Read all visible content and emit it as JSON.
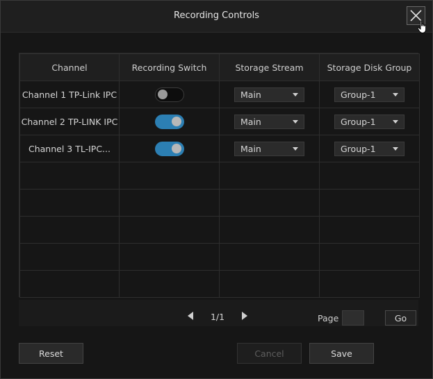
{
  "dialog": {
    "title": "Recording Controls",
    "close_icon": "close-icon"
  },
  "table": {
    "headers": [
      "Channel",
      "Recording Switch",
      "Storage Stream",
      "Storage Disk Group"
    ],
    "rows": [
      {
        "channel": "Channel 1 TP-Link IPC",
        "recording": false,
        "stream": "Main",
        "group": "Group-1"
      },
      {
        "channel": "Channel 2 TP-LINK IPC",
        "recording": true,
        "stream": "Main",
        "group": "Group-1"
      },
      {
        "channel": "Channel 3 TL-IPC...",
        "recording": true,
        "stream": "Main",
        "group": "Group-1"
      }
    ],
    "empty_rows": 5
  },
  "pager": {
    "current": "1/1",
    "page_label": "Page",
    "page_value": "",
    "go_label": "Go"
  },
  "footer": {
    "reset_label": "Reset",
    "cancel_label": "Cancel",
    "save_label": "Save"
  },
  "colors": {
    "accent": "#2c7fb3",
    "background": "#161616",
    "header": "#1f1f1f"
  }
}
